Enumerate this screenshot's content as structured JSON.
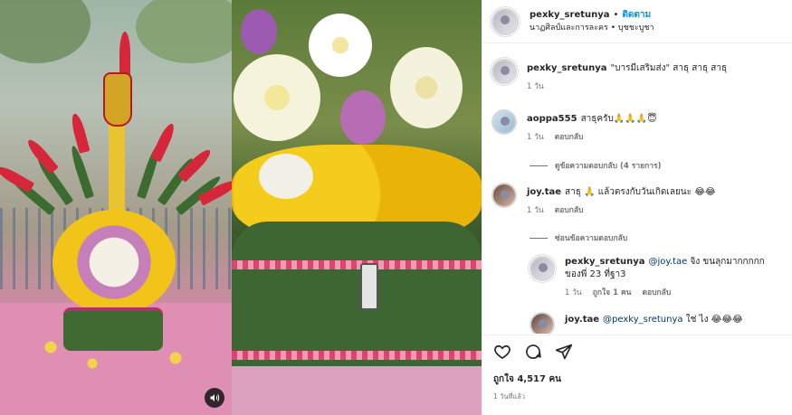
{
  "header": {
    "username": "pexky_sretunya",
    "separator": "•",
    "follow_label": "ติดตาม",
    "subtitle": "นาฏศิลป์และการละคร • บุชชะบูชา"
  },
  "caption": {
    "username": "pexky_sretunya",
    "text": "\"บารมีเสริมส่ง\" สาธุ สาธุ สาธุ",
    "time": "1 วัน"
  },
  "comments": [
    {
      "username": "aoppa555",
      "text": "สาธุครับ🙏🙏🙏😇",
      "time": "1 วัน",
      "reply_label": "ตอบกลับ",
      "view_replies": "ดูข้อความตอบกลับ (4 รายการ)"
    },
    {
      "username": "joy.tae",
      "text": "สาธุ 🙏 แล้วตรงกับวันเกิดเลยนะ 😂😂",
      "time": "1 วัน",
      "reply_label": "ตอบกลับ",
      "hide_replies": "ซ่อนข้อความตอบกลับ"
    }
  ],
  "replies": [
    {
      "username": "pexky_sretunya",
      "mention": "@joy.tae",
      "text": "จิง ขนลุกมากกกกก ของพี่ 23 ที่ฐา3",
      "time": "1 วัน",
      "likes_label": "ถูกใจ 1 คน",
      "reply_label": "ตอบกลับ"
    },
    {
      "username": "joy.tae",
      "mention": "@pexky_sretunya",
      "text": "ใช่ ไง 😂😂😂"
    }
  ],
  "footer": {
    "likes": "ถูกใจ 4,517 คน",
    "posted": "1 วันที่แล้ว"
  },
  "icons": {
    "like": "heart-icon",
    "comment": "comment-icon",
    "share": "share-icon",
    "sound": "speaker-icon"
  }
}
